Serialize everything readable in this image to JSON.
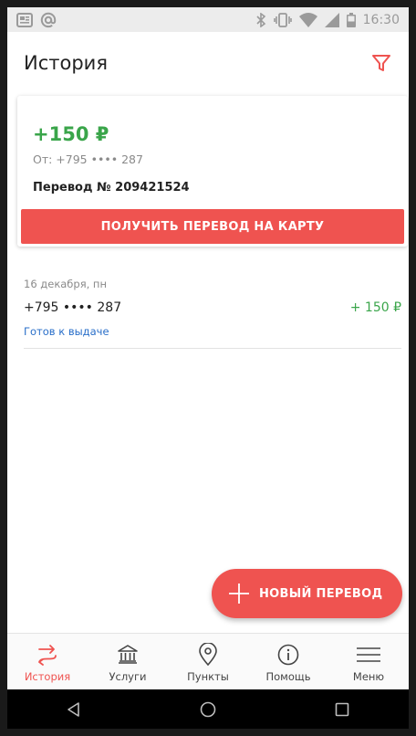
{
  "status_bar": {
    "time": "16:30",
    "left_icons": [
      "news-icon",
      "at-sign-icon"
    ],
    "right_icons": [
      "bluetooth-icon",
      "vibrate-icon",
      "wifi-icon",
      "signal-icon",
      "battery-icon"
    ]
  },
  "header": {
    "title": "История",
    "filter_icon": "filter-icon"
  },
  "card": {
    "amount": "+150 ₽",
    "from": "От: +795 •••• 287",
    "transfer": "Перевод № 209421524",
    "button_label": "ПОЛУЧИТЬ ПЕРЕВОД НА КАРТУ"
  },
  "history": [
    {
      "date": "16 декабря, пн",
      "phone": "+795 •••• 287",
      "amount": "+ 150 ₽",
      "status": "Готов к выдаче"
    }
  ],
  "fab": {
    "label": "НОВЫЙ ПЕРЕВОД",
    "icon": "plus-icon"
  },
  "bottom_nav": [
    {
      "label": "История",
      "icon": "transfer-arrows-icon",
      "active": true
    },
    {
      "label": "Услуги",
      "icon": "bank-icon",
      "active": false
    },
    {
      "label": "Пункты",
      "icon": "location-pin-icon",
      "active": false
    },
    {
      "label": "Помощь",
      "icon": "info-icon",
      "active": false
    },
    {
      "label": "Меню",
      "icon": "hamburger-menu-icon",
      "active": false
    }
  ],
  "system_nav": [
    "back-icon",
    "home-icon",
    "recents-icon"
  ],
  "colors": {
    "accent": "#ef5350",
    "positive": "#3aa54a",
    "link": "#2a6fc9"
  }
}
